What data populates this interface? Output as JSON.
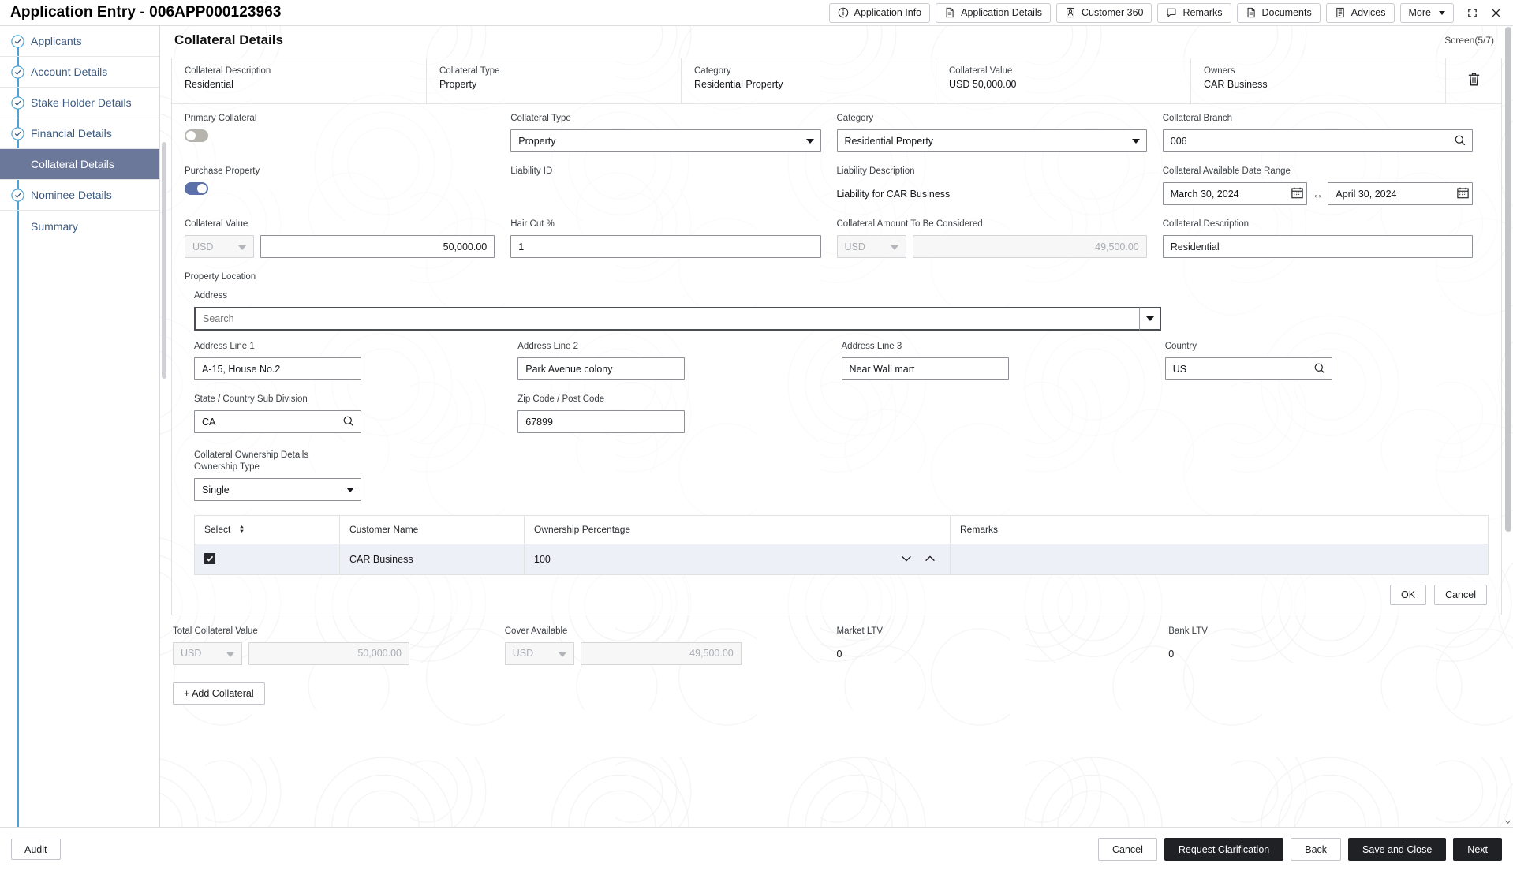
{
  "header": {
    "title": "Application Entry - 006APP000123963",
    "toolbar_buttons": [
      {
        "label": "Application Info",
        "icon": "info-circle-icon"
      },
      {
        "label": "Application Details",
        "icon": "document-icon"
      },
      {
        "label": "Customer 360",
        "icon": "person-card-icon"
      },
      {
        "label": "Remarks",
        "icon": "comment-icon"
      },
      {
        "label": "Documents",
        "icon": "document-icon"
      },
      {
        "label": "Advices",
        "icon": "list-document-icon"
      },
      {
        "label": "More",
        "icon": "chevron-down-icon"
      }
    ],
    "window_controls": {
      "minimize": "collapse-icon",
      "close": "close-icon"
    }
  },
  "sidebar": {
    "items": [
      {
        "label": "Applicants",
        "state": "complete"
      },
      {
        "label": "Account Details",
        "state": "complete"
      },
      {
        "label": "Stake Holder Details",
        "state": "complete"
      },
      {
        "label": "Financial Details",
        "state": "complete"
      },
      {
        "label": "Collateral Details",
        "state": "active"
      },
      {
        "label": "Nominee Details",
        "state": "complete"
      },
      {
        "label": "Summary",
        "state": "pending"
      }
    ]
  },
  "page": {
    "title": "Collateral Details",
    "screen_indicator": "Screen(5/7)"
  },
  "summary_strip": {
    "cells": [
      {
        "label": "Collateral Description",
        "value": "Residential"
      },
      {
        "label": "Collateral Type",
        "value": "Property"
      },
      {
        "label": "Category",
        "value": "Residential Property"
      },
      {
        "label": "Collateral Value",
        "value": "USD 50,000.00"
      },
      {
        "label": "Owners",
        "value": "CAR Business"
      }
    ],
    "delete_icon": "trash-icon"
  },
  "form": {
    "primary_collateral": {
      "label": "Primary Collateral",
      "state": "off"
    },
    "collateral_type": {
      "label": "Collateral Type",
      "value": "Property"
    },
    "category": {
      "label": "Category",
      "value": "Residential Property"
    },
    "collateral_branch": {
      "label": "Collateral Branch",
      "value": "006",
      "icon": "search-icon"
    },
    "purchase_property": {
      "label": "Purchase Property",
      "state": "on"
    },
    "liability_id": {
      "label": "Liability ID",
      "value": ""
    },
    "liability_description": {
      "label": "Liability Description",
      "value": "Liability for CAR Business"
    },
    "date_range": {
      "label": "Collateral Available Date Range",
      "from": "March 30, 2024",
      "to": "April 30, 2024",
      "separator": "↔",
      "icon": "calendar-icon"
    },
    "collateral_value": {
      "label": "Collateral Value",
      "currency": "USD",
      "amount": "50,000.00"
    },
    "hair_cut": {
      "label": "Hair Cut %",
      "value": "1"
    },
    "amount_considered": {
      "label": "Collateral Amount To Be Considered",
      "currency": "USD",
      "amount": "49,500.00",
      "disabled": true
    },
    "collateral_description": {
      "label": "Collateral Description",
      "value": "Residential"
    },
    "property_location": {
      "label": "Property Location"
    },
    "address": {
      "label": "Address",
      "placeholder": "Search",
      "value": ""
    },
    "address_line_1": {
      "label": "Address Line 1",
      "value": "A-15, House No.2"
    },
    "address_line_2": {
      "label": "Address Line 2",
      "value": "Park Avenue colony"
    },
    "address_line_3": {
      "label": "Address Line 3",
      "value": "Near Wall mart"
    },
    "country": {
      "label": "Country",
      "value": "US",
      "icon": "search-icon"
    },
    "state": {
      "label": "State / Country Sub Division",
      "value": "CA",
      "icon": "search-icon"
    },
    "zip": {
      "label": "Zip Code / Post Code",
      "value": "67899"
    }
  },
  "ownership": {
    "section_title": "Collateral Ownership Details",
    "type_label": "Ownership Type",
    "type_value": "Single",
    "columns": [
      "Select",
      "Customer Name",
      "Ownership Percentage",
      "Remarks"
    ],
    "rows": [
      {
        "selected": true,
        "customer_name": "CAR Business",
        "percentage": "100",
        "remarks": ""
      }
    ],
    "ok_label": "OK",
    "cancel_label": "Cancel"
  },
  "totals": {
    "total_collateral_value": {
      "label": "Total Collateral Value",
      "currency": "USD",
      "amount": "50,000.00"
    },
    "cover_available": {
      "label": "Cover Available",
      "currency": "USD",
      "amount": "49,500.00"
    },
    "market_ltv": {
      "label": "Market LTV",
      "value": "0"
    },
    "bank_ltv": {
      "label": "Bank LTV",
      "value": "0"
    }
  },
  "add_collateral_label": "+ Add Collateral",
  "footer": {
    "audit_label": "Audit",
    "cancel_label": "Cancel",
    "request_clarification_label": "Request Clarification",
    "back_label": "Back",
    "save_close_label": "Save and Close",
    "next_label": "Next"
  },
  "colors": {
    "active_step_bg": "#6b7899",
    "step_line": "#4da3d6",
    "link_text": "#3d5a80",
    "toggle_on": "#5b6fa8",
    "row_highlight": "#eef0f7",
    "dark_button": "#1f2124"
  }
}
